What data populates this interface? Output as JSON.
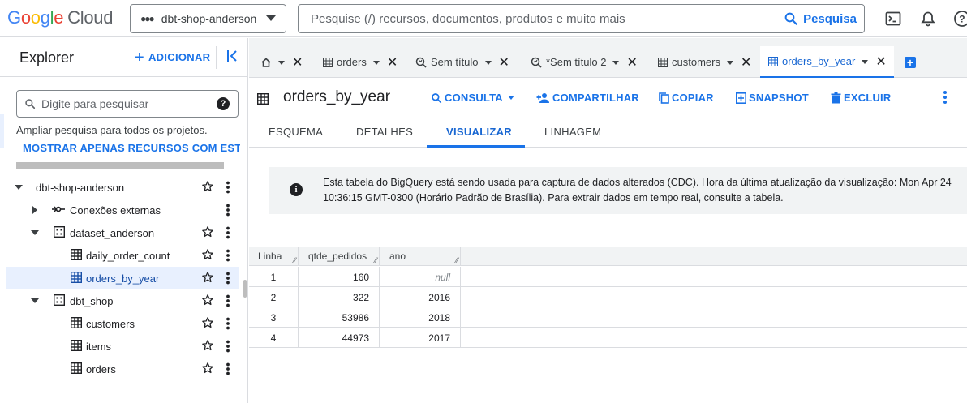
{
  "header": {
    "logo_google": "Google",
    "logo_cloud": "Cloud",
    "project": "dbt-shop-anderson",
    "search_placeholder": "Pesquise (/) recursos, documentos, produtos e muito mais",
    "search_button": "Pesquisa"
  },
  "explorer": {
    "title": "Explorer",
    "add_label": "ADICIONAR",
    "search_placeholder": "Digite para pesquisar",
    "expand_text": "Ampliar pesquisa para todos os projetos.",
    "starred_link": "MOSTRAR APENAS RECURSOS COM ESTRELA",
    "tree": [
      {
        "label": "dbt-shop-anderson",
        "type": "project",
        "expanded": true
      },
      {
        "label": "Conexões externas",
        "type": "connections",
        "expanded": false
      },
      {
        "label": "dataset_anderson",
        "type": "dataset",
        "expanded": true
      },
      {
        "label": "daily_order_count",
        "type": "table"
      },
      {
        "label": "orders_by_year",
        "type": "table",
        "selected": true
      },
      {
        "label": "dbt_shop",
        "type": "dataset",
        "expanded": true
      },
      {
        "label": "customers",
        "type": "table"
      },
      {
        "label": "items",
        "type": "table"
      },
      {
        "label": "orders",
        "type": "table"
      }
    ]
  },
  "tabs": [
    {
      "label": "",
      "icon": "home-icon"
    },
    {
      "label": "orders",
      "icon": "table-icon"
    },
    {
      "label": "Sem título",
      "icon": "query-icon"
    },
    {
      "label": "*Sem título 2",
      "icon": "query-icon"
    },
    {
      "label": "customers",
      "icon": "table-icon"
    },
    {
      "label": "orders_by_year",
      "icon": "table-icon",
      "active": true
    }
  ],
  "toolbar": {
    "title": "orders_by_year",
    "query": "CONSULTA",
    "share": "COMPARTILHAR",
    "copy": "COPIAR",
    "snapshot": "SNAPSHOT",
    "delete": "EXCLUIR"
  },
  "subtabs": [
    {
      "label": "ESQUEMA"
    },
    {
      "label": "DETALHES"
    },
    {
      "label": "VISUALIZAR",
      "active": true
    },
    {
      "label": "LINHAGEM"
    }
  ],
  "banner": {
    "line1": "Esta tabela do BigQuery está sendo usada para captura de dados alterados (CDC). Hora da última atualização da visualização: Mon Apr 24",
    "line2": "10:36:15 GMT-0300 (Horário Padrão de Brasília). Para extrair dados em tempo real, consulte a tabela."
  },
  "table": {
    "columns": [
      "Linha",
      "qtde_pedidos",
      "ano"
    ],
    "rows": [
      [
        "1",
        "160",
        "null"
      ],
      [
        "2",
        "322",
        "2016"
      ],
      [
        "3",
        "53986",
        "2018"
      ],
      [
        "4",
        "44973",
        "2017"
      ]
    ]
  },
  "colors": {
    "accent": "#1a73e8",
    "selected_bg": "#e8f0fe",
    "header_bg": "#f1f3f4"
  }
}
